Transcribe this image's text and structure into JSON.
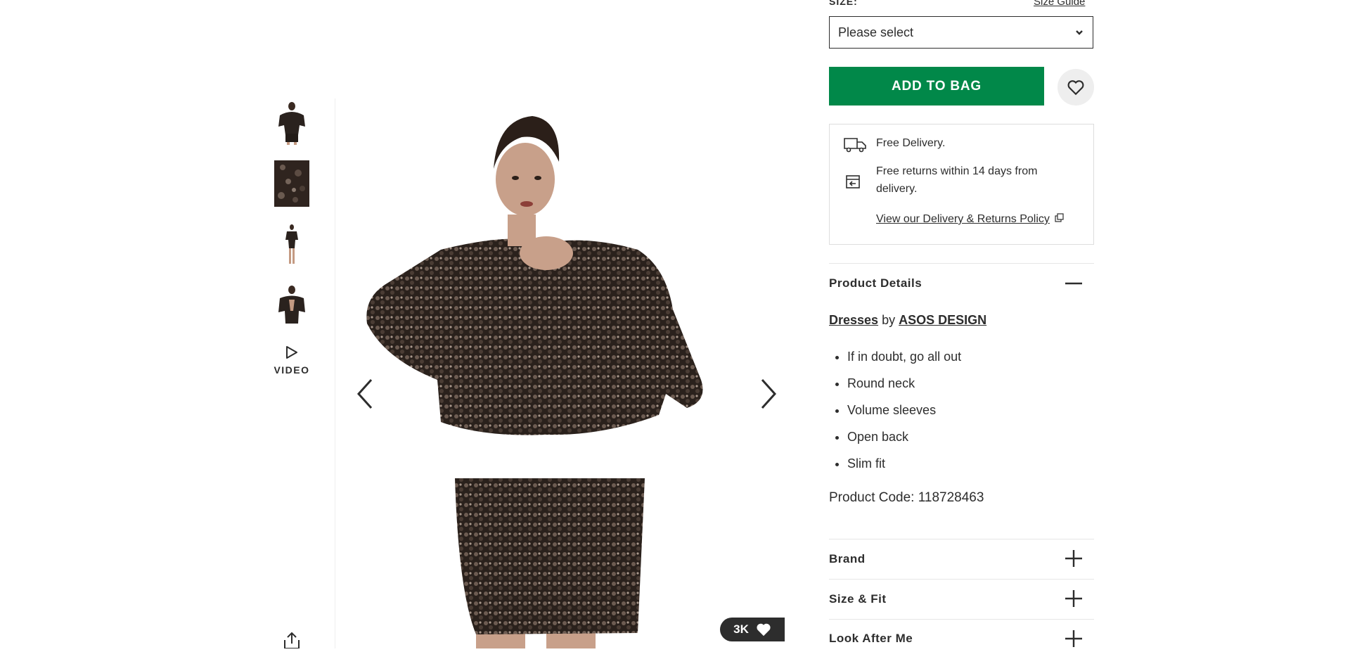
{
  "gallery": {
    "thumbnails": [
      {
        "name": "thumbnail-front-view"
      },
      {
        "name": "thumbnail-sequin-detail"
      },
      {
        "name": "thumbnail-full-length"
      },
      {
        "name": "thumbnail-back-view"
      }
    ],
    "video_label": "VIDEO",
    "saves_count": "3K"
  },
  "purchase": {
    "size_label": "SIZE:",
    "size_guide": "Size Guide",
    "size_select_value": "Please select",
    "add_to_bag": "ADD TO BAG"
  },
  "delivery": {
    "free_delivery": "Free Delivery.",
    "free_returns_line1": "Free returns within 14 days from",
    "free_returns_line2": "delivery.",
    "policy_link": "View our Delivery & Returns Policy"
  },
  "product_details": {
    "title": "Product Details",
    "category": "Dresses",
    "by": "by",
    "brand": "ASOS DESIGN",
    "bullets": [
      "If in doubt, go all out",
      "Round neck",
      "Volume sleeves",
      "Open back",
      "Slim fit"
    ],
    "product_code": "Product Code: 118728463"
  },
  "accordions": {
    "brand": "Brand",
    "size_fit": "Size & Fit",
    "look_after_me": "Look After Me"
  },
  "colors": {
    "accent_green": "#018849",
    "text": "#2d2d2d",
    "divider": "#e6e6e6"
  },
  "icons": [
    "chevron-down-icon",
    "heart-icon",
    "truck-icon",
    "returns-icon",
    "external-link-icon",
    "minus-icon",
    "plus-icon",
    "play-icon",
    "share-icon",
    "arrow-left-icon",
    "arrow-right-icon"
  ]
}
